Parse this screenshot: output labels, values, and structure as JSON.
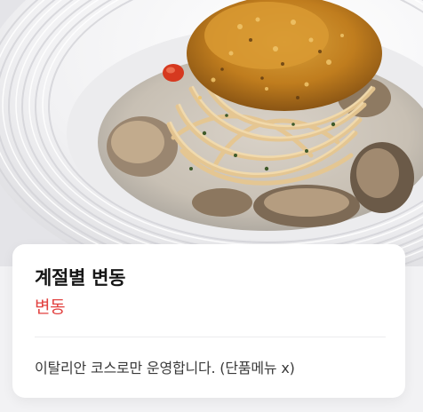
{
  "photo": {
    "description_icon": "pasta-dish-photo"
  },
  "card": {
    "title": "계절별 변동",
    "subtitle": "변동",
    "note": "이탈리안 코스로만 운영합니다. (단품메뉴 x)"
  },
  "colors": {
    "subtitle": "#e2413f",
    "card_background": "#ffffff",
    "page_background": "#f2f2f4"
  }
}
